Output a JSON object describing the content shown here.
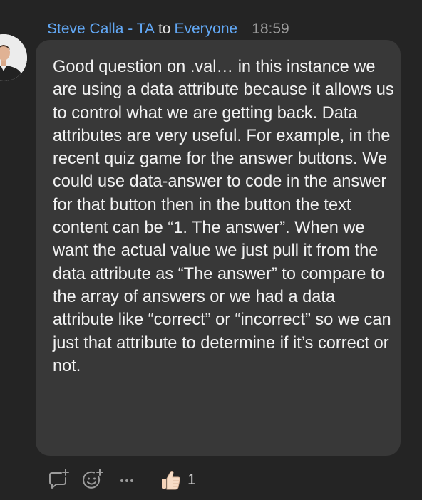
{
  "header": {
    "sender": "Steve Calla - TA",
    "to_word": "to",
    "recipient": "Everyone",
    "time": "18:59"
  },
  "message": {
    "text": "Good question on .val… in this instance we are using a data attribute because it allows us to control what we are getting back. Data attributes are very useful. For example, in the recent quiz game for the answer buttons. We could use data-answer to code in the answer for that button then in the button the text content can be “1. The answer”. When we want the actual value we just pull it from the data attribute as “The answer” to compare to the array of answers or we had a data attribute like “correct” or “incorrect” so we can just that attribute to determine if it’s correct or not."
  },
  "actions": {
    "reply_icon": "reply-plus-icon",
    "emoji_icon": "emoji-plus-icon",
    "more_icon": "more-dots-icon",
    "reaction_icon": "thumbs-up-icon",
    "reaction_count": "1"
  },
  "colors": {
    "background": "#242424",
    "bubble": "#383838",
    "link": "#62a8f5",
    "text": "#f2f2f2",
    "muted": "#9b9b9b"
  }
}
